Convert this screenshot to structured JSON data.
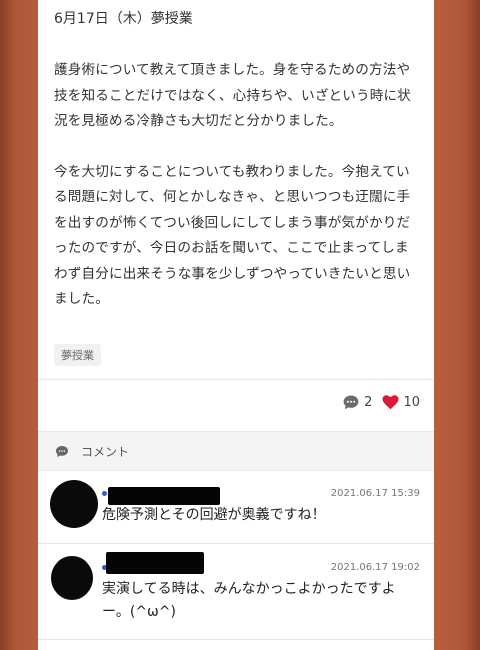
{
  "post": {
    "title": "6月17日（木）夢授業",
    "paragraphs": [
      "護身術について教えて頂きました。身を守るための方法や技を知ることだけではなく、心持ちや、いざという時に状況を見極める冷静さも大切だと分かりました。",
      "今を大切にすることについても教わりました。今抱えている問題に対して、何とかしなきゃ、と思いつつも迂闊に手を出すのが怖くてつい後回しにしてしまう事が気がかりだったのですが、今日のお話を聞いて、ここで止まってしまわず自分に出来そうな事を少しずつやっていきたいと思いました。"
    ],
    "tag": "夢授業",
    "comment_count": "2",
    "like_count": "10",
    "comment_icon": "speech-bubble-icon",
    "like_icon": "heart-icon",
    "like_color": "#d81b3c"
  },
  "comments_section": {
    "label": "コメント",
    "icon": "speech-bubble-icon",
    "items": [
      {
        "date": "2021.06.17 15:39",
        "text": "危険予測とその回避が奥義ですね！"
      },
      {
        "date": "2021.06.17 19:02",
        "text": "実演してる時は、みんなかっこよかったですよー。(^ω^)"
      }
    ]
  }
}
